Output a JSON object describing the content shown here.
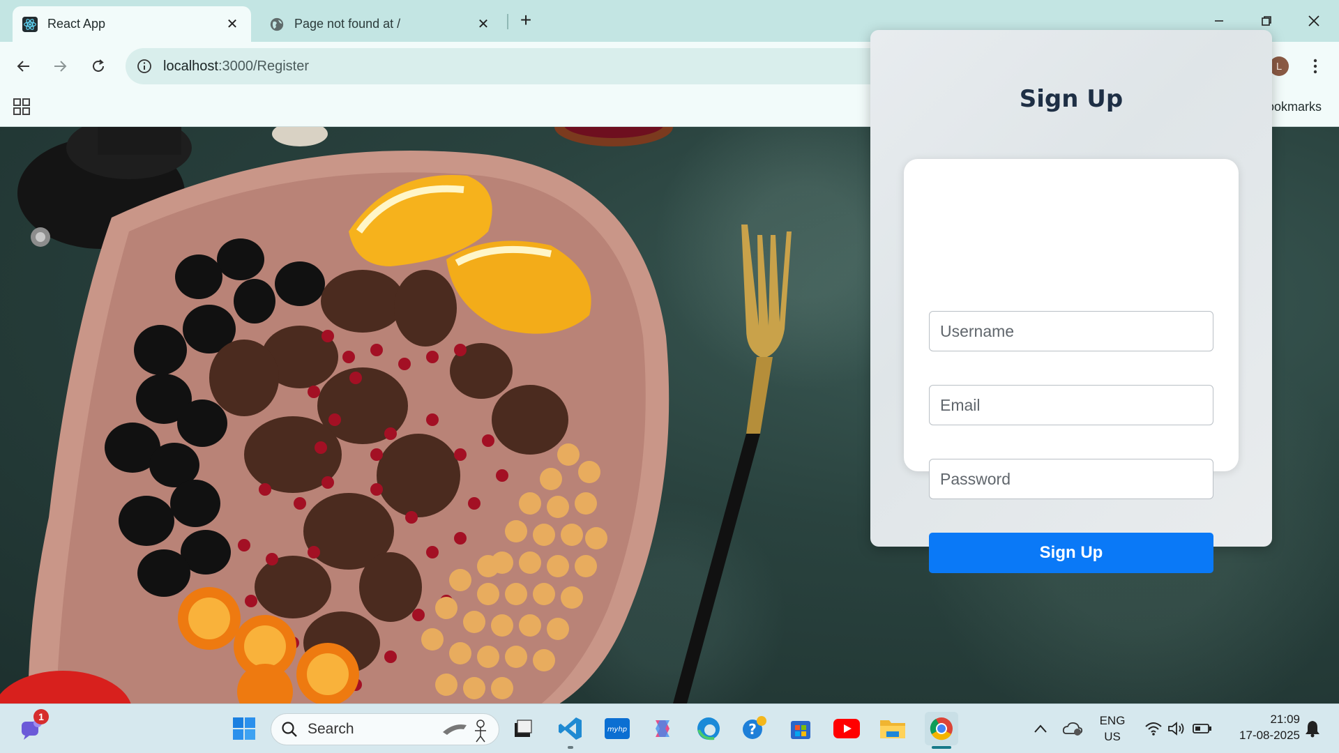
{
  "browser": {
    "tabs": [
      {
        "title": "React App",
        "active": true
      },
      {
        "title": "Page not found at /",
        "active": false
      }
    ],
    "url": {
      "host": "localhost",
      "rest": ":3000/Register"
    },
    "bookmarks": {
      "all_label": "All Bookmarks"
    },
    "profile_initial": "L"
  },
  "page": {
    "title": "Sign Up",
    "fields": {
      "username_placeholder": "Username",
      "email_placeholder": "Email",
      "password_placeholder": "Password"
    },
    "submit_label": "Sign Up",
    "accent": "#0a79f7"
  },
  "taskbar": {
    "search_label": "Search",
    "notification_count": "1",
    "lang_line1": "ENG",
    "lang_line2": "US",
    "time": "21:09",
    "date": "17-08-2025"
  }
}
